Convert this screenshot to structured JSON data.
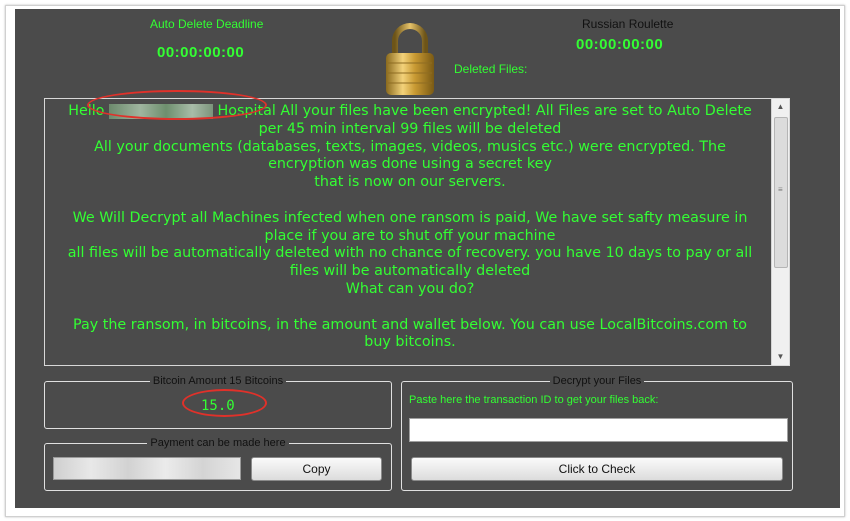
{
  "header": {
    "deadline_label": "Auto Delete Deadline",
    "deadline_value": "00:00:00:00",
    "roulette_label": "Russian Roulette",
    "roulette_value": "00:00:00:00",
    "deleted_files_label": "Deleted Files:",
    "lock_icon": "padlock-icon"
  },
  "message": {
    "greeting_prefix": "Hello",
    "greeting_suffix": "Hospital",
    "line1_rest": "All your files have been encrypted! All Files are set to Auto Delete",
    "line2": "per 45 min interval 99 files will be deleted",
    "line3": "All your documents (databases, texts, images, videos, musics etc.) were encrypted. The",
    "line4": "encryption was done using a secret key",
    "line5": "that is now on our servers.",
    "line6": "We Will Decrypt all Machines infected when one ransom is paid, We have set safty measure in",
    "line7": "place if you are to shut off your machine",
    "line8": "all files will be automatically deleted with no chance of recovery. you have 10 days to pay or all",
    "line9": "files will be automatically deleted",
    "line10": "What can you do?",
    "line11": "Pay the ransom, in bitcoins, in the amount and wallet below. You can use LocalBitcoins.com to",
    "line12": "buy bitcoins."
  },
  "bitcoin": {
    "group_title": "Bitcoin Amount 15 Bitcoins",
    "amount": "15.0"
  },
  "payment": {
    "group_title": "Payment can be made here",
    "copy_label": "Copy"
  },
  "decrypt": {
    "group_title": "Decrypt your Files",
    "hint": "Paste here the transaction ID to get your files back:",
    "tx_value": "",
    "check_label": "Click to Check"
  },
  "colors": {
    "background": "#4b4b4b",
    "text_green": "#33ff33",
    "highlight_red": "#e0312a"
  }
}
